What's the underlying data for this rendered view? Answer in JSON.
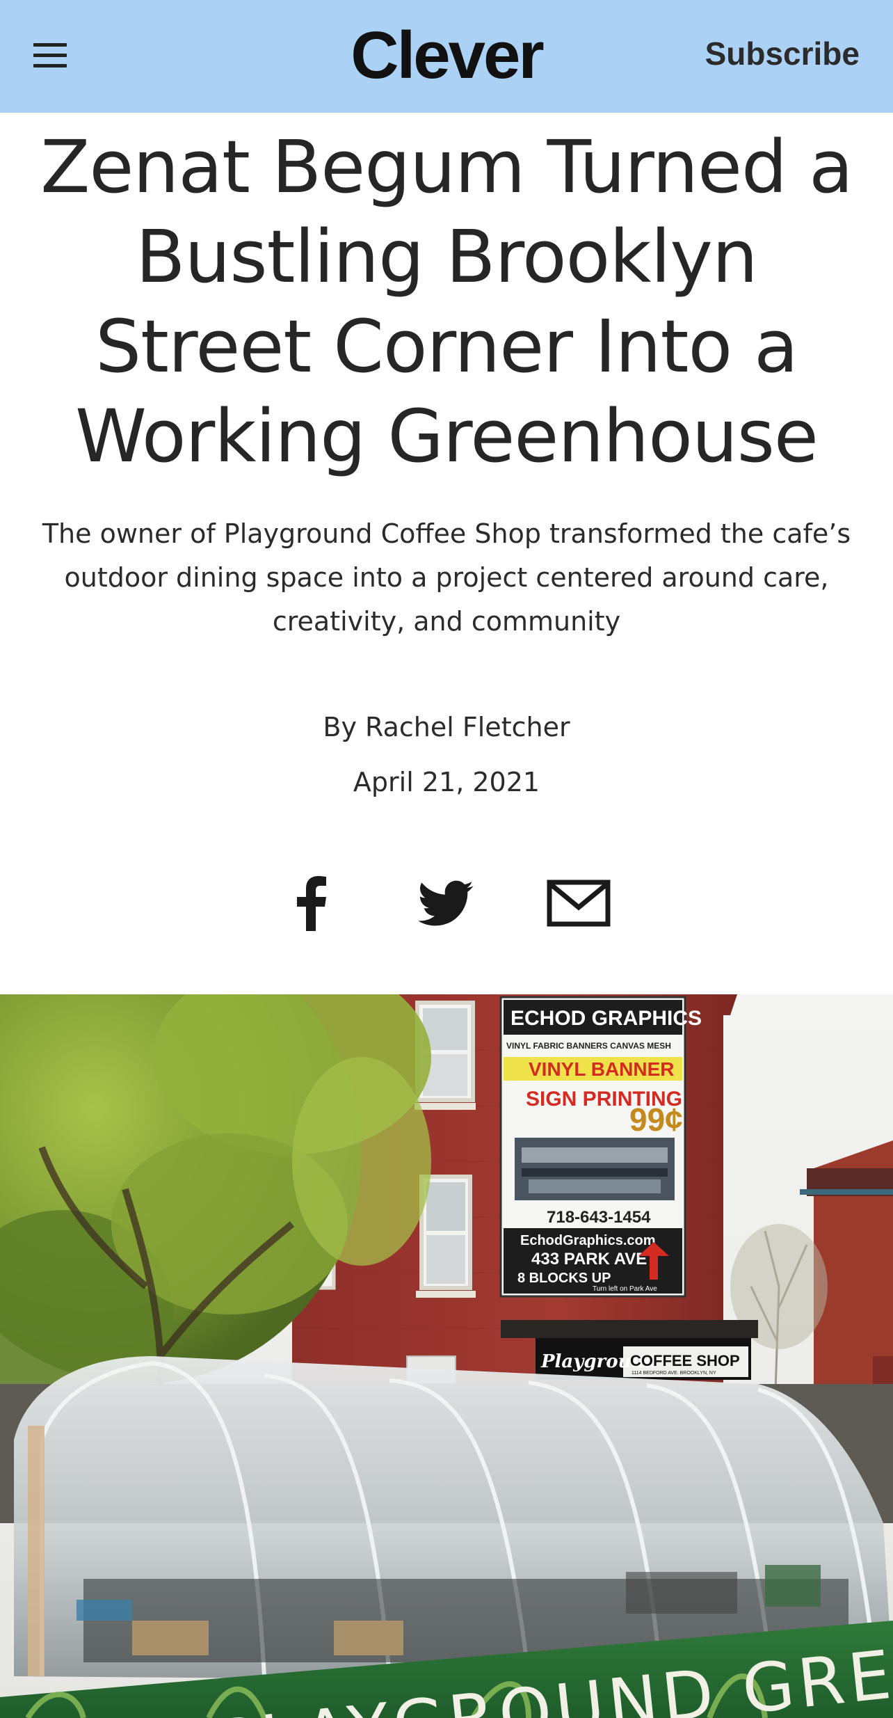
{
  "header": {
    "logo": "Clever",
    "subscribe_label": "Subscribe",
    "menu_icon": "hamburger-menu-icon",
    "background_color": "#abd1f5"
  },
  "article": {
    "headline": "Zenat Begum Turned a Bustling Brooklyn Street Corner Into a Working Greenhouse",
    "dek": "The owner of Playground Coffee Shop transformed the cafe’s outdoor dining space into a project centered around care, creativity, and community",
    "byline_prefix": "By ",
    "author": "Rachel Fletcher",
    "date": "April 21, 2021"
  },
  "share": {
    "icons": [
      "facebook-icon",
      "twitter-icon",
      "email-icon"
    ]
  },
  "hero_image": {
    "billboard": {
      "line1": "ECHOD GRAPHICS",
      "line2": "VINYL FABRIC BANNERS CANVAS MESH",
      "line3": "VINYL BANNER",
      "line4": "SIGN PRINTING",
      "price": "99¢",
      "phone": "718-643-1454",
      "website": "EchodGraphics.com",
      "address": "433 PARK AVE",
      "blocks": "8 BLOCKS UP",
      "turn": "Turn left on Park Ave"
    },
    "awning": {
      "name": "Playground",
      "type": "COFFEE SHOP",
      "address": "1114 BEDFORD AVE. BROOKLYN, NY"
    },
    "planter_text": "PLAYGROUND GREENHOUSE"
  }
}
